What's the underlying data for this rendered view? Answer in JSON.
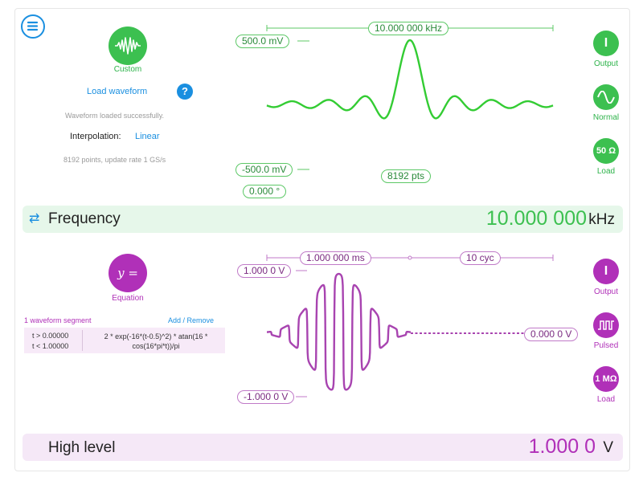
{
  "colors": {
    "green": "#2db34a",
    "purple": "#b030b8",
    "blue": "#1a8fe0",
    "green_band": "#e6f7ea",
    "purple_band": "#f5e8f7"
  },
  "top": {
    "waveform_type": "Custom",
    "load_waveform": "Load waveform",
    "help": "?",
    "status": "Waveform loaded successfully.",
    "interpolation_label": "Interpolation:",
    "interpolation_value": "Linear",
    "points_info": "8192 points, update rate 1 GS/s",
    "freq_pill": "10.000 000 kHz",
    "high_pill": "500.0 mV",
    "low_pill": "-500.0 mV",
    "phase_pill": "0.000 °",
    "pts_pill": "8192 pts",
    "output_btn": "I",
    "output_label": "Output",
    "mode_label": "Normal",
    "load_btn": "50 Ω",
    "load_label": "Load"
  },
  "frequency": {
    "label": "Frequency",
    "value": "10.000 000",
    "unit": "kHz"
  },
  "bottom": {
    "waveform_type": "Equation",
    "eq_icon": "y =",
    "segment_count": "1 waveform segment",
    "add_remove": "Add / Remove",
    "t_start": "t > 0.00000",
    "t_end": "t < 1.00000",
    "equation": "2 * exp(-16*(t-0.5)^2) * atan(16 * cos(16*pi*t))/pi",
    "time_pill": "1.000 000 ms",
    "cycles_pill": "10 cyc",
    "high_pill": "1.000 0 V",
    "low_pill": "-1.000 0 V",
    "idle_pill": "0.000 0 V",
    "output_btn": "I",
    "output_label": "Output",
    "mode_label": "Pulsed",
    "load_btn": "1 MΩ",
    "load_label": "Load"
  },
  "high_level": {
    "label": "High level",
    "value": "1.000 0",
    "unit": "V"
  },
  "icons": [
    "menu-icon",
    "sinc-waveform-icon",
    "swap-arrows-icon",
    "sine-wave-icon",
    "pulse-icon",
    "power-icon"
  ]
}
